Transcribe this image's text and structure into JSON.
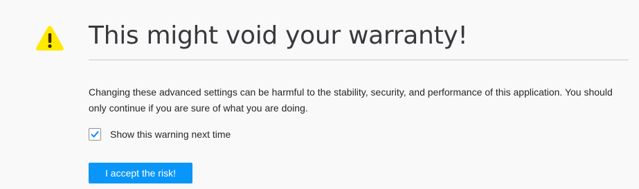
{
  "warning": {
    "title": "This might void your warranty!",
    "description": "Changing these advanced settings can be harmful to the stability, security, and performance of this application. You should only continue if you are sure of what you are doing.",
    "icon": "warning-triangle-icon"
  },
  "checkbox": {
    "label": "Show this warning next time",
    "checked": true,
    "icon": "checkmark-icon"
  },
  "accept_button": {
    "label": "I accept the risk!"
  },
  "colors": {
    "background": "#f9f9fa",
    "accent": "#0996f8",
    "warning": "#ffe900",
    "title_text": "#38383d"
  }
}
